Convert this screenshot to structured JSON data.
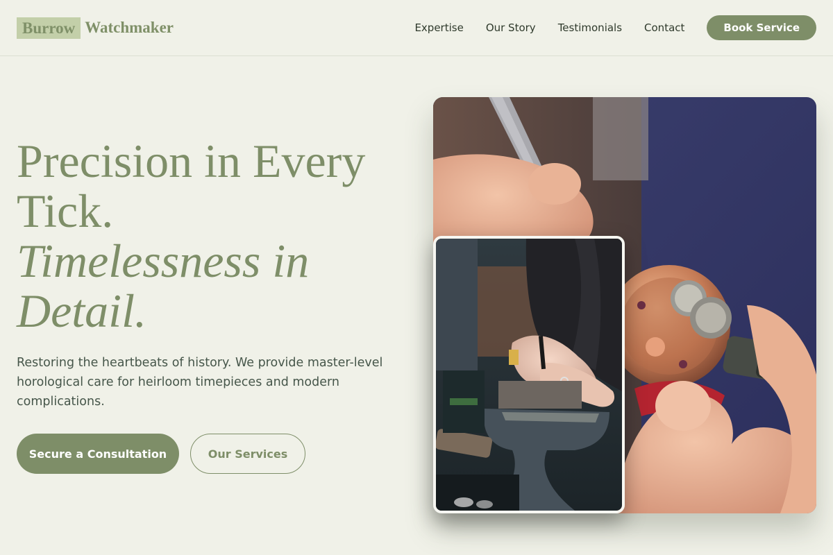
{
  "brand": {
    "part1": "Burrow",
    "part2": "Watchmaker"
  },
  "nav": {
    "items": [
      "Expertise",
      "Our Story",
      "Testimonials",
      "Contact"
    ],
    "cta": "Book Service"
  },
  "hero": {
    "line1": "Precision in Every",
    "line2": "Tick.",
    "line3": "Timelessness in",
    "line4": "Detail.",
    "subtitle": "Restoring the heartbeats of history. We provide master-level horological care for heirloom timepieces and modern complications.",
    "primary_cta": "Secure a Consultation",
    "secondary_cta": "Our Services"
  },
  "colors": {
    "background": "#f0f1e8",
    "accent": "#7e8e68",
    "logo_highlight": "#c3cfa9",
    "text": "#2f3a2c"
  },
  "images": {
    "main": "watch-movement-photo",
    "inset": "watchmaker-workbench-photo"
  }
}
